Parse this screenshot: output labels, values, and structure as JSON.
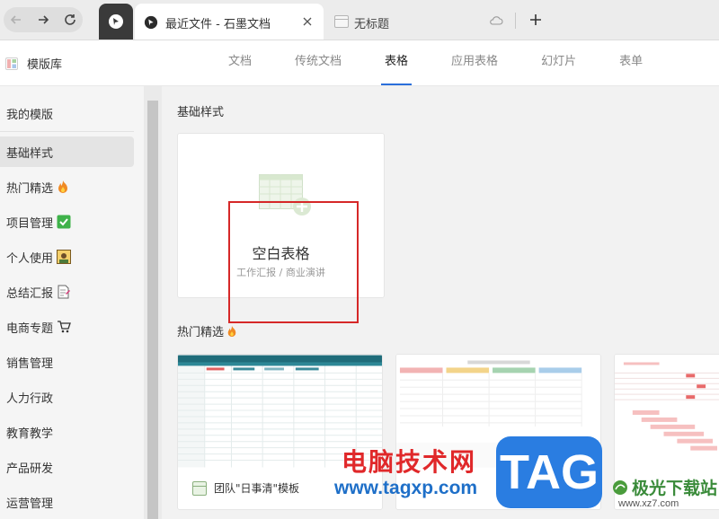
{
  "browser": {
    "active_tab_title": "最近文件 - 石墨文档",
    "second_tab_title": "无标题"
  },
  "header": {
    "brand": "模版库",
    "categories": [
      "文档",
      "传统文档",
      "表格",
      "应用表格",
      "幻灯片",
      "表单"
    ],
    "active_category": "表格"
  },
  "sidebar": {
    "items": [
      {
        "label": "我的模版",
        "emoji": ""
      },
      {
        "label": "基础样式",
        "emoji": ""
      },
      {
        "label": "热门精选",
        "emoji": "fire-icon"
      },
      {
        "label": "项目管理",
        "emoji": "check-icon"
      },
      {
        "label": "个人使用",
        "emoji": "portrait-icon"
      },
      {
        "label": "总结汇报",
        "emoji": "memo-icon"
      },
      {
        "label": "电商专题",
        "emoji": "cart-icon"
      },
      {
        "label": "销售管理",
        "emoji": ""
      },
      {
        "label": "人力行政",
        "emoji": ""
      },
      {
        "label": "教育教学",
        "emoji": ""
      },
      {
        "label": "产品研发",
        "emoji": ""
      },
      {
        "label": "运营管理",
        "emoji": ""
      }
    ],
    "active_index": 1
  },
  "main": {
    "section_basic": "基础样式",
    "blank_card": {
      "title": "空白表格",
      "subtitle": "工作汇报 / 商业演讲"
    },
    "section_hot": "热门精选",
    "templates": [
      {
        "label": "团队\"日事清\"模板"
      },
      {
        "label": ""
      },
      {
        "label": ""
      }
    ]
  },
  "watermark": {
    "cn_text": "电脑技术网",
    "url": "www.tagxp.com",
    "tag": "TAG",
    "jg_text": "极光下载站",
    "jg_url": "www.xz7.com"
  },
  "colors": {
    "accent": "#2a6fdb",
    "highlight_box": "#d62828",
    "sheet_green": "#8bb07e"
  }
}
